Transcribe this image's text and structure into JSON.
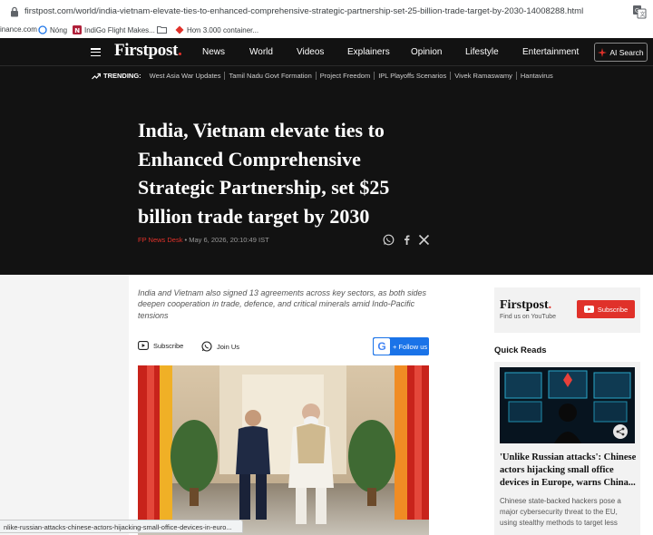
{
  "browser": {
    "url": "firstpost.com/world/india-vietnam-elevate-ties-to-enhanced-comprehensive-strategic-partnership-set-25-billion-trade-target-by-2030-14008288.html",
    "bookmarks": [
      "inance.com",
      "Nóng",
      "IndiGo Flight Makes...",
      "",
      "Hơn 3.000 container..."
    ],
    "status_url": "nlike-russian-attacks-chinese-actors-hijacking-small-office-devices-in-euro..."
  },
  "nav": {
    "logo_main": "Firstpost",
    "logo_dot": ".",
    "links": [
      "News",
      "World",
      "Videos",
      "Explainers",
      "Opinion",
      "Lifestyle",
      "Entertainment"
    ],
    "ai_search": "AI Search"
  },
  "trending": {
    "label": "TRENDING:",
    "items": [
      "West Asia War Updates",
      "Tamil Nadu Govt Formation",
      "Project Freedom",
      "IPL Playoffs Scenarios",
      "Vivek Ramaswamy",
      "Hantavirus"
    ]
  },
  "article": {
    "headline": "India, Vietnam elevate ties to Enhanced Comprehensive Strategic Partnership, set $25 billion trade target by 2030",
    "author": "FP News Desk",
    "date": " • May 6, 2026, 20:10:49 IST",
    "dek": "India and Vietnam also signed 13 agreements across key sectors, as both sides deepen cooperation in trade, defence, and critical minerals amid Indo-Pacific tensions",
    "subscribe": "Subscribe",
    "join_us": "Join Us",
    "follow": "+ Follow us"
  },
  "sidebar": {
    "promo_logo": "Firstpost",
    "promo_dot": ".",
    "promo_sub": "Find us on YouTube",
    "subscribe": "Subscribe",
    "quick_reads_title": "Quick Reads",
    "quick_read": {
      "headline": "'Unlike Russian attacks': Chinese actors hijacking small office devices in Europe, warns China...",
      "summary": "Chinese state-backed hackers pose a major cybersecurity threat to the EU, using stealthy methods to target less"
    }
  },
  "colors": {
    "brand_red": "#e0312a",
    "dark_bg": "#121212",
    "google_blue": "#1a73e8"
  }
}
